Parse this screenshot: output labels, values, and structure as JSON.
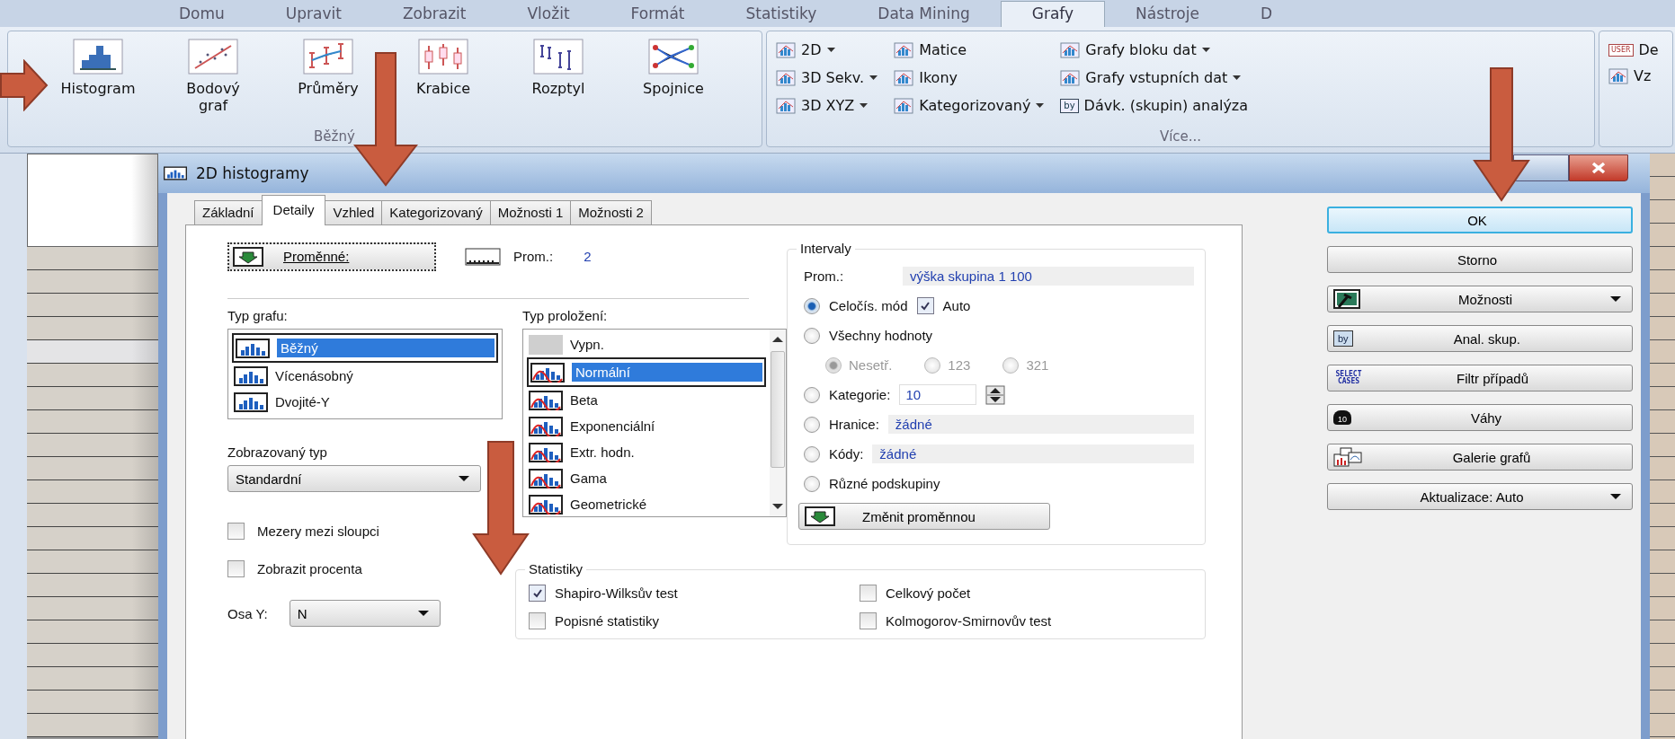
{
  "app_tabs": [
    {
      "label": "Domu",
      "selected": false
    },
    {
      "label": "Upravit",
      "selected": false
    },
    {
      "label": "Zobrazit",
      "selected": false
    },
    {
      "label": "Vložit",
      "selected": false
    },
    {
      "label": "Formát",
      "selected": false
    },
    {
      "label": "Statistiky",
      "selected": false
    },
    {
      "label": "Data Mining",
      "selected": false
    },
    {
      "label": "Grafy",
      "selected": true
    },
    {
      "label": "Nástroje",
      "selected": false
    },
    {
      "label": "D",
      "selected": false
    }
  ],
  "ribbon": {
    "common": {
      "label": "Běžný",
      "buttons": [
        {
          "label": "Histogram"
        },
        {
          "label": "Bodový graf"
        },
        {
          "label": "Průměry"
        },
        {
          "label": "Krabice"
        },
        {
          "label": "Rozptyl"
        },
        {
          "label": "Spojnice"
        }
      ]
    },
    "more": {
      "label": "Více...",
      "columns": [
        [
          {
            "label": "2D",
            "dropdown": true
          },
          {
            "label": "3D Sekv.",
            "dropdown": true
          },
          {
            "label": "3D XYZ",
            "dropdown": true
          }
        ],
        [
          {
            "label": "Matice",
            "dropdown": false
          },
          {
            "label": "Ikony",
            "dropdown": false
          },
          {
            "label": "Kategorizovaný",
            "dropdown": true
          }
        ],
        [
          {
            "label": "Grafy bloku dat",
            "dropdown": true
          },
          {
            "label": "Grafy vstupních dat",
            "dropdown": true
          },
          {
            "label": "Dávk. (skupin) analýza",
            "dropdown": false,
            "icon_text": "by"
          }
        ]
      ]
    },
    "extra": [
      {
        "label": "De",
        "icon_text": "USER"
      },
      {
        "label": "Vz"
      }
    ]
  },
  "grid_rows": [
    {
      "selected": false
    },
    {
      "selected": false
    },
    {
      "selected": false
    },
    {
      "selected": false
    },
    {
      "selected": true
    },
    {
      "selected": false
    },
    {
      "selected": false
    },
    {
      "selected": false
    },
    {
      "selected": false
    },
    {
      "selected": false
    },
    {
      "selected": false
    },
    {
      "selected": false
    },
    {
      "selected": false
    },
    {
      "selected": false
    },
    {
      "selected": false
    },
    {
      "selected": false
    },
    {
      "selected": false
    },
    {
      "selected": false
    },
    {
      "selected": false
    },
    {
      "selected": false
    },
    {
      "selected": false
    }
  ],
  "dialog": {
    "title": "2D histogramy",
    "tabs": [
      {
        "label": "Základní",
        "selected": false
      },
      {
        "label": "Detaily",
        "selected": true
      },
      {
        "label": "Vzhled",
        "selected": false
      },
      {
        "label": "Kategorizovaný",
        "selected": false
      },
      {
        "label": "Možnosti 1",
        "selected": false
      },
      {
        "label": "Možnosti 2",
        "selected": false
      }
    ],
    "variables_button": "Proměnné:",
    "prom_label": "Prom.:",
    "prom_value": "2",
    "graph_type": {
      "label": "Typ grafu:",
      "items": [
        {
          "label": "Běžný",
          "selected": true
        },
        {
          "label": "Vícenásobný",
          "selected": false
        },
        {
          "label": "Dvojité-Y",
          "selected": false
        }
      ]
    },
    "fit_type": {
      "label": "Typ proložení:",
      "items": [
        {
          "label": "Vypn.",
          "selected": false
        },
        {
          "label": "Normální",
          "selected": true
        },
        {
          "label": "Beta",
          "selected": false
        },
        {
          "label": "Exponenciální",
          "selected": false
        },
        {
          "label": "Extr. hodn.",
          "selected": false
        },
        {
          "label": "Gama",
          "selected": false
        },
        {
          "label": "Geometrické",
          "selected": false
        }
      ]
    },
    "display_type": {
      "label": "Zobrazovaný typ",
      "value": "Standardní"
    },
    "options": [
      {
        "label": "Mezery mezi sloupci",
        "checked": false
      },
      {
        "label": "Zobrazit procenta",
        "checked": false
      }
    ],
    "y_axis": {
      "label": "Osa Y:",
      "value": "N"
    },
    "intervals": {
      "title": "Intervaly",
      "prom_label": "Prom.:",
      "prom_value": "výška skupina 1 100",
      "modes": [
        {
          "kind": "auto",
          "label": "Celočís. mód",
          "selected": true,
          "auto": {
            "label": "Auto",
            "checked": true
          }
        },
        {
          "kind": "sub",
          "label": "Všechny hodnoty",
          "selected": false,
          "sub": [
            {
              "label": "Nesetř.",
              "selected": true
            },
            {
              "label": "123",
              "selected": false
            },
            {
              "label": "321",
              "selected": false
            }
          ]
        },
        {
          "kind": "spin",
          "label": "Kategorie:",
          "selected": false,
          "value": "10"
        },
        {
          "kind": "field",
          "label": "Hranice:",
          "selected": false,
          "value": "žádné"
        },
        {
          "kind": "field",
          "label": "Kódy:",
          "selected": false,
          "value": "žádné"
        },
        {
          "kind": "plain",
          "label": "Různé podskupiny",
          "selected": false
        }
      ],
      "change_button": "Změnit proměnnou"
    },
    "statistics": {
      "title": "Statistiky",
      "items": [
        {
          "label": "Shapiro-Wilksův test",
          "checked": true
        },
        {
          "label": "Celkový počet",
          "checked": false
        },
        {
          "label": "Popisné statistiky",
          "checked": false
        },
        {
          "label": "Kolmogorov-Smirnovův test",
          "checked": false
        }
      ]
    },
    "buttons": [
      {
        "label": "OK",
        "kind": "default"
      },
      {
        "label": "Storno",
        "kind": "plain"
      },
      {
        "label": "Možnosti",
        "kind": "options",
        "dropdown": true
      },
      {
        "label": "Anal. skup.",
        "kind": "by",
        "icon_text": "by"
      },
      {
        "label": "Filtr případů",
        "kind": "select",
        "icon_text": "SELECT CASES"
      },
      {
        "label": "Váhy",
        "kind": "weight",
        "icon_text": "10"
      },
      {
        "label": "Galerie grafů",
        "kind": "gallery"
      },
      {
        "label": "Aktualizace: Auto",
        "kind": "update",
        "dropdown": true
      }
    ]
  }
}
